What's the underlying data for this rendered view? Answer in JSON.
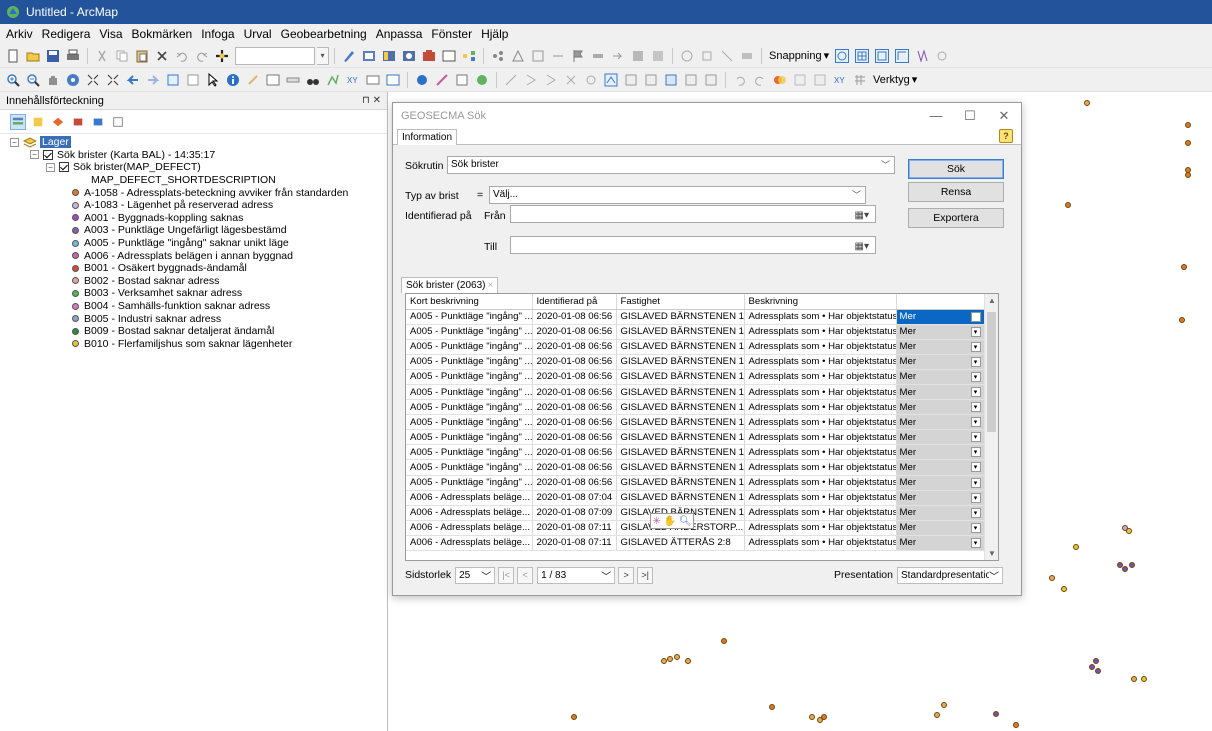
{
  "window": {
    "title": "Untitled - ArcMap"
  },
  "menu": [
    "Arkiv",
    "Redigera",
    "Visa",
    "Bokmärken",
    "Infoga",
    "Urval",
    "Geobearbetning",
    "Anpassa",
    "Fönster",
    "Hjälp"
  ],
  "toolbar": {
    "snapping_label": "Snappning",
    "verktyg_label": "Verktyg"
  },
  "toc": {
    "title": "Innehållsförteckning",
    "root": "Lager",
    "group": "Sök brister (Karta BAL) - 14:35:17",
    "layer": "Sök brister(MAP_DEFECT)",
    "field": "MAP_DEFECT_SHORTDESCRIPTION",
    "legend": [
      {
        "label": "A-1058 - Adressplats-beteckning avviker från standarden",
        "color": "#d9792b"
      },
      {
        "label": "A-1083 - Lägenhet på reserverad adress",
        "color": "#c8b5d8"
      },
      {
        "label": "A001 - Byggnads-koppling saknas",
        "color": "#9a4fc0"
      },
      {
        "label": "A003 - Punktläge Ungefärligt lägesbestämd",
        "color": "#8a5db5"
      },
      {
        "label": "A005 - Punktläge \"ingång\" saknar unikt läge",
        "color": "#74b7d6"
      },
      {
        "label": "A006 - Adressplats belägen i annan byggnad",
        "color": "#c565a8"
      },
      {
        "label": "B001 - Osäkert byggnads-ändamål",
        "color": "#d24a3a"
      },
      {
        "label": "B002 - Bostad saknar adress",
        "color": "#e3a2a0"
      },
      {
        "label": "B003 - Verksamhet saknar adress",
        "color": "#57b451"
      },
      {
        "label": "B004 - Samhälls-funktion saknar adress",
        "color": "#d77ab8"
      },
      {
        "label": "B005 - Industri saknar adress",
        "color": "#8ea2c6"
      },
      {
        "label": "B009 - Bostad saknar detaljerat ändamål",
        "color": "#2f8a3c"
      },
      {
        "label": "B010 - Flerfamiljshus som saknar lägenheter",
        "color": "#e6c43a"
      }
    ]
  },
  "dialog": {
    "title": "GEOSECMA Sök",
    "tab": "Information",
    "sokrutin_label": "Sökrutin",
    "sokrutin_value": "Sök brister",
    "typ_label": "Typ av brist",
    "typ_eq": "=",
    "typ_value": "Välj...",
    "identifierad_label": "Identifierad på",
    "fran_label": "Från",
    "till_label": "Till",
    "buttons": {
      "search": "Sök",
      "clear": "Rensa",
      "export": "Exportera"
    },
    "results_tab": "Sök brister (2063)",
    "columns": [
      "Kort beskrivning",
      "Identifierad på",
      "Fastighet",
      "Beskrivning",
      ""
    ],
    "rows": [
      [
        "A005 - Punktläge \"ingång\" ...",
        "2020-01-08 06:56",
        "GISLAVED BÄRNSTENEN 1",
        "Adressplats som • Har objektstatus...",
        "Mer"
      ],
      [
        "A005 - Punktläge \"ingång\" ...",
        "2020-01-08 06:56",
        "GISLAVED BÄRNSTENEN 1",
        "Adressplats som • Har objektstatus...",
        "Mer"
      ],
      [
        "A005 - Punktläge \"ingång\" ...",
        "2020-01-08 06:56",
        "GISLAVED BÄRNSTENEN 1",
        "Adressplats som • Har objektstatus...",
        "Mer"
      ],
      [
        "A005 - Punktläge \"ingång\" ...",
        "2020-01-08 06:56",
        "GISLAVED BÄRNSTENEN 1",
        "Adressplats som • Har objektstatus...",
        "Mer"
      ],
      [
        "A005 - Punktläge \"ingång\" ...",
        "2020-01-08 06:56",
        "GISLAVED BÄRNSTENEN 1",
        "Adressplats som • Har objektstatus...",
        "Mer"
      ],
      [
        "A005 - Punktläge \"ingång\" ...",
        "2020-01-08 06:56",
        "GISLAVED BÄRNSTENEN 1",
        "Adressplats som • Har objektstatus...",
        "Mer"
      ],
      [
        "A005 - Punktläge \"ingång\" ...",
        "2020-01-08 06:56",
        "GISLAVED BÄRNSTENEN 1",
        "Adressplats som • Har objektstatus...",
        "Mer"
      ],
      [
        "A005 - Punktläge \"ingång\" ...",
        "2020-01-08 06:56",
        "GISLAVED BÄRNSTENEN 1",
        "Adressplats som • Har objektstatus...",
        "Mer"
      ],
      [
        "A005 - Punktläge \"ingång\" ...",
        "2020-01-08 06:56",
        "GISLAVED BÄRNSTENEN 1",
        "Adressplats som • Har objektstatus...",
        "Mer"
      ],
      [
        "A005 - Punktläge \"ingång\" ...",
        "2020-01-08 06:56",
        "GISLAVED BÄRNSTENEN 1",
        "Adressplats som • Har objektstatus...",
        "Mer"
      ],
      [
        "A005 - Punktläge \"ingång\" ...",
        "2020-01-08 06:56",
        "GISLAVED BÄRNSTENEN 1",
        "Adressplats som • Har objektstatus...",
        "Mer"
      ],
      [
        "A005 - Punktläge \"ingång\" ...",
        "2020-01-08 06:56",
        "GISLAVED BÄRNSTENEN 1",
        "Adressplats som • Har objektstatus...",
        "Mer"
      ],
      [
        "A006 - Adressplats beläge...",
        "2020-01-08 07:04",
        "GISLAVED BÄRNSTENEN 1",
        "Adressplats som • Har objektstatus...",
        "Mer"
      ],
      [
        "A006 - Adressplats beläge...",
        "2020-01-08 07:09",
        "GISLAVED BÄRNSTENEN 1",
        "Adressplats som • Har objektstatus...",
        "Mer"
      ],
      [
        "A006 - Adressplats beläge...",
        "2020-01-08 07:11",
        "GISLAVED ANDERSTORP...",
        "Adressplats som • Har objektstatus...",
        "Mer"
      ],
      [
        "A006 - Adressplats beläge...",
        "2020-01-08 07:11",
        "GISLAVED ÄTTERÅS 2:8",
        "Adressplats som • Har objektstatus...",
        "Mer"
      ]
    ],
    "pager": {
      "size_label": "Sidstorlek",
      "size_value": "25",
      "page_value": "1 / 83",
      "presentation_label": "Presentation",
      "presentation_value": "Standardpresentatior"
    }
  }
}
